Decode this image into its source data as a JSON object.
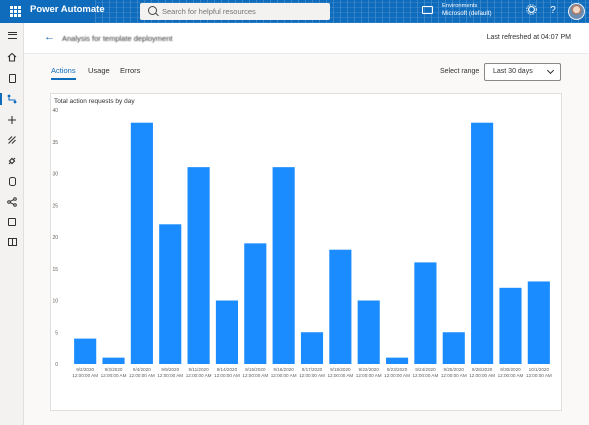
{
  "app": {
    "name": "Power Automate",
    "user_initials": ""
  },
  "search": {
    "placeholder": "Search for helpful resources"
  },
  "environment": {
    "label": "Environments",
    "name": "Microsoft (default)"
  },
  "icons": {
    "waffle": "app-launcher-icon",
    "search": "search-icon",
    "environment": "environment-icon",
    "settings": "gear-icon",
    "help": "question-icon",
    "back": "back-arrow-icon"
  },
  "rail": [
    {
      "name": "menu",
      "icon": "hamburger-icon"
    },
    {
      "name": "home",
      "icon": "home-icon"
    },
    {
      "name": "action-items",
      "icon": "clipboard-icon"
    },
    {
      "name": "my-flows",
      "icon": "flow-icon",
      "active": true
    },
    {
      "name": "create",
      "icon": "plus-icon"
    },
    {
      "name": "templates",
      "icon": "templates-icon"
    },
    {
      "name": "connectors",
      "icon": "connector-icon"
    },
    {
      "name": "data",
      "icon": "database-icon"
    },
    {
      "name": "monitor",
      "icon": "monitor-icon"
    },
    {
      "name": "ai-builder",
      "icon": "ai-builder-icon"
    },
    {
      "name": "learn",
      "icon": "book-icon"
    }
  ],
  "page": {
    "title": "Analysis for template deployment",
    "refreshed": "Last refreshed at 04:07 PM"
  },
  "tabs": [
    {
      "label": "Actions",
      "active": true
    },
    {
      "label": "Usage"
    },
    {
      "label": "Errors"
    }
  ],
  "range": {
    "label": "Select range",
    "value": "Last 30 days"
  },
  "colors": {
    "accent": "#0f6cbd",
    "bar": "#1a8cff",
    "topbar": "#0f6cbd"
  },
  "chart_data": {
    "type": "bar",
    "title": "Total action requests by day",
    "categories": [
      [
        "9/2/2020",
        "12:00:00 AM"
      ],
      [
        "9/3/2020",
        "12:00:00 AM"
      ],
      [
        "9/4/2020",
        "12:00:00 AM"
      ],
      [
        "9/9/2020",
        "12:00:00 AM"
      ],
      [
        "9/11/2020",
        "12:00:00 AM"
      ],
      [
        "9/14/2020",
        "12:00:00 AM"
      ],
      [
        "9/15/2020",
        "12:00:00 AM"
      ],
      [
        "9/16/2020",
        "12:00:00 AM"
      ],
      [
        "9/17/2020",
        "12:00:00 AM"
      ],
      [
        "9/18/2020",
        "12:00:00 AM"
      ],
      [
        "9/22/2020",
        "12:00:00 AM"
      ],
      [
        "9/23/2020",
        "12:00:00 AM"
      ],
      [
        "9/24/2020",
        "12:00:00 AM"
      ],
      [
        "9/25/2020",
        "12:00:00 AM"
      ],
      [
        "9/28/2020",
        "12:00:00 AM"
      ],
      [
        "9/30/2020",
        "12:00:00 AM"
      ],
      [
        "10/1/2020",
        "12:00:00 AM"
      ]
    ],
    "values": [
      4,
      1,
      38,
      22,
      31,
      10,
      19,
      31,
      5,
      18,
      10,
      1,
      16,
      5,
      38,
      12,
      13
    ],
    "yticks": [
      0,
      5,
      10,
      15,
      20,
      25,
      30,
      35,
      40
    ],
    "ylim": [
      0,
      40
    ],
    "grid": false,
    "legend": "none"
  }
}
